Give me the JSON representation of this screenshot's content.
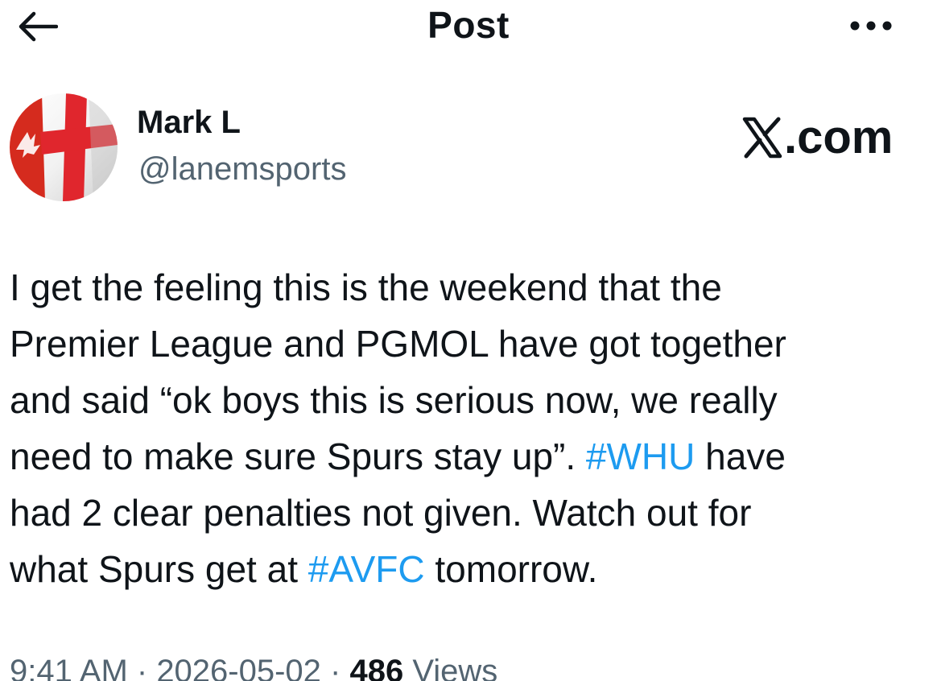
{
  "header": {
    "title": "Post"
  },
  "author": {
    "name": "Mark L",
    "handle": "@lanemsports"
  },
  "watermark": {
    "text": ".com",
    "logo_icon": "x-logo-icon"
  },
  "tweet": {
    "lines": [
      [
        {
          "text": "I get the feeling this is the weekend that the"
        }
      ],
      [
        {
          "text": "Premier League and PGMOL have got together"
        }
      ],
      [
        {
          "text": "and said “ok boys this is serious now, we really"
        }
      ],
      [
        {
          "text": "need to make sure Spurs stay up”. "
        },
        {
          "text": "#WHU",
          "hashtag": true
        },
        {
          "text": " have"
        }
      ],
      [
        {
          "text": "had 2 clear penalties not given. Watch out for"
        }
      ],
      [
        {
          "text": "what Spurs get at "
        },
        {
          "text": "#AVFC",
          "hashtag": true
        },
        {
          "text": " tomorrow."
        }
      ]
    ]
  },
  "meta": {
    "time": "9:41 AM",
    "separator": " · ",
    "date": "2026-05-02",
    "views_count": "486",
    "views_label": " Views"
  },
  "colors": {
    "hashtag": "#1d9bf0",
    "secondary_text": "#536471",
    "primary_text": "#0f1419"
  }
}
